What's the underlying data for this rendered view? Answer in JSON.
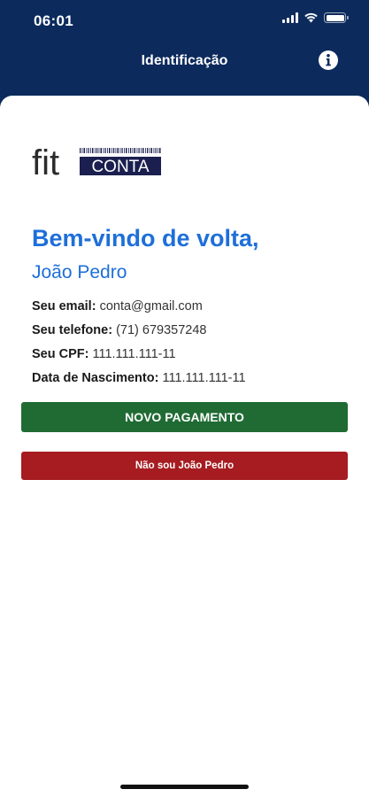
{
  "status_bar": {
    "time": "06:01"
  },
  "nav": {
    "title": "Identificação",
    "info_icon": "info-circle-icon"
  },
  "logo": {
    "text_fit": "fit",
    "text_conta": "CONTA"
  },
  "greeting": {
    "title": "Bem-vindo de volta,",
    "name": "João Pedro"
  },
  "details": [
    {
      "label": "Seu email:",
      "value": "conta@gmail.com"
    },
    {
      "label": "Seu telefone:",
      "value": "(71) 679357248"
    },
    {
      "label": "Seu CPF:",
      "value": "111.111.111-11"
    },
    {
      "label": "Data de Nascimento:",
      "value": "111.111.111-11"
    }
  ],
  "buttons": {
    "new_payment": "NOVO PAGAMENTO",
    "not_me": "Não sou João Pedro"
  },
  "colors": {
    "header_bg": "#0c2a5c",
    "accent_blue": "#1e6fd9",
    "primary_green": "#1f6b33",
    "danger_red": "#a61c20"
  }
}
